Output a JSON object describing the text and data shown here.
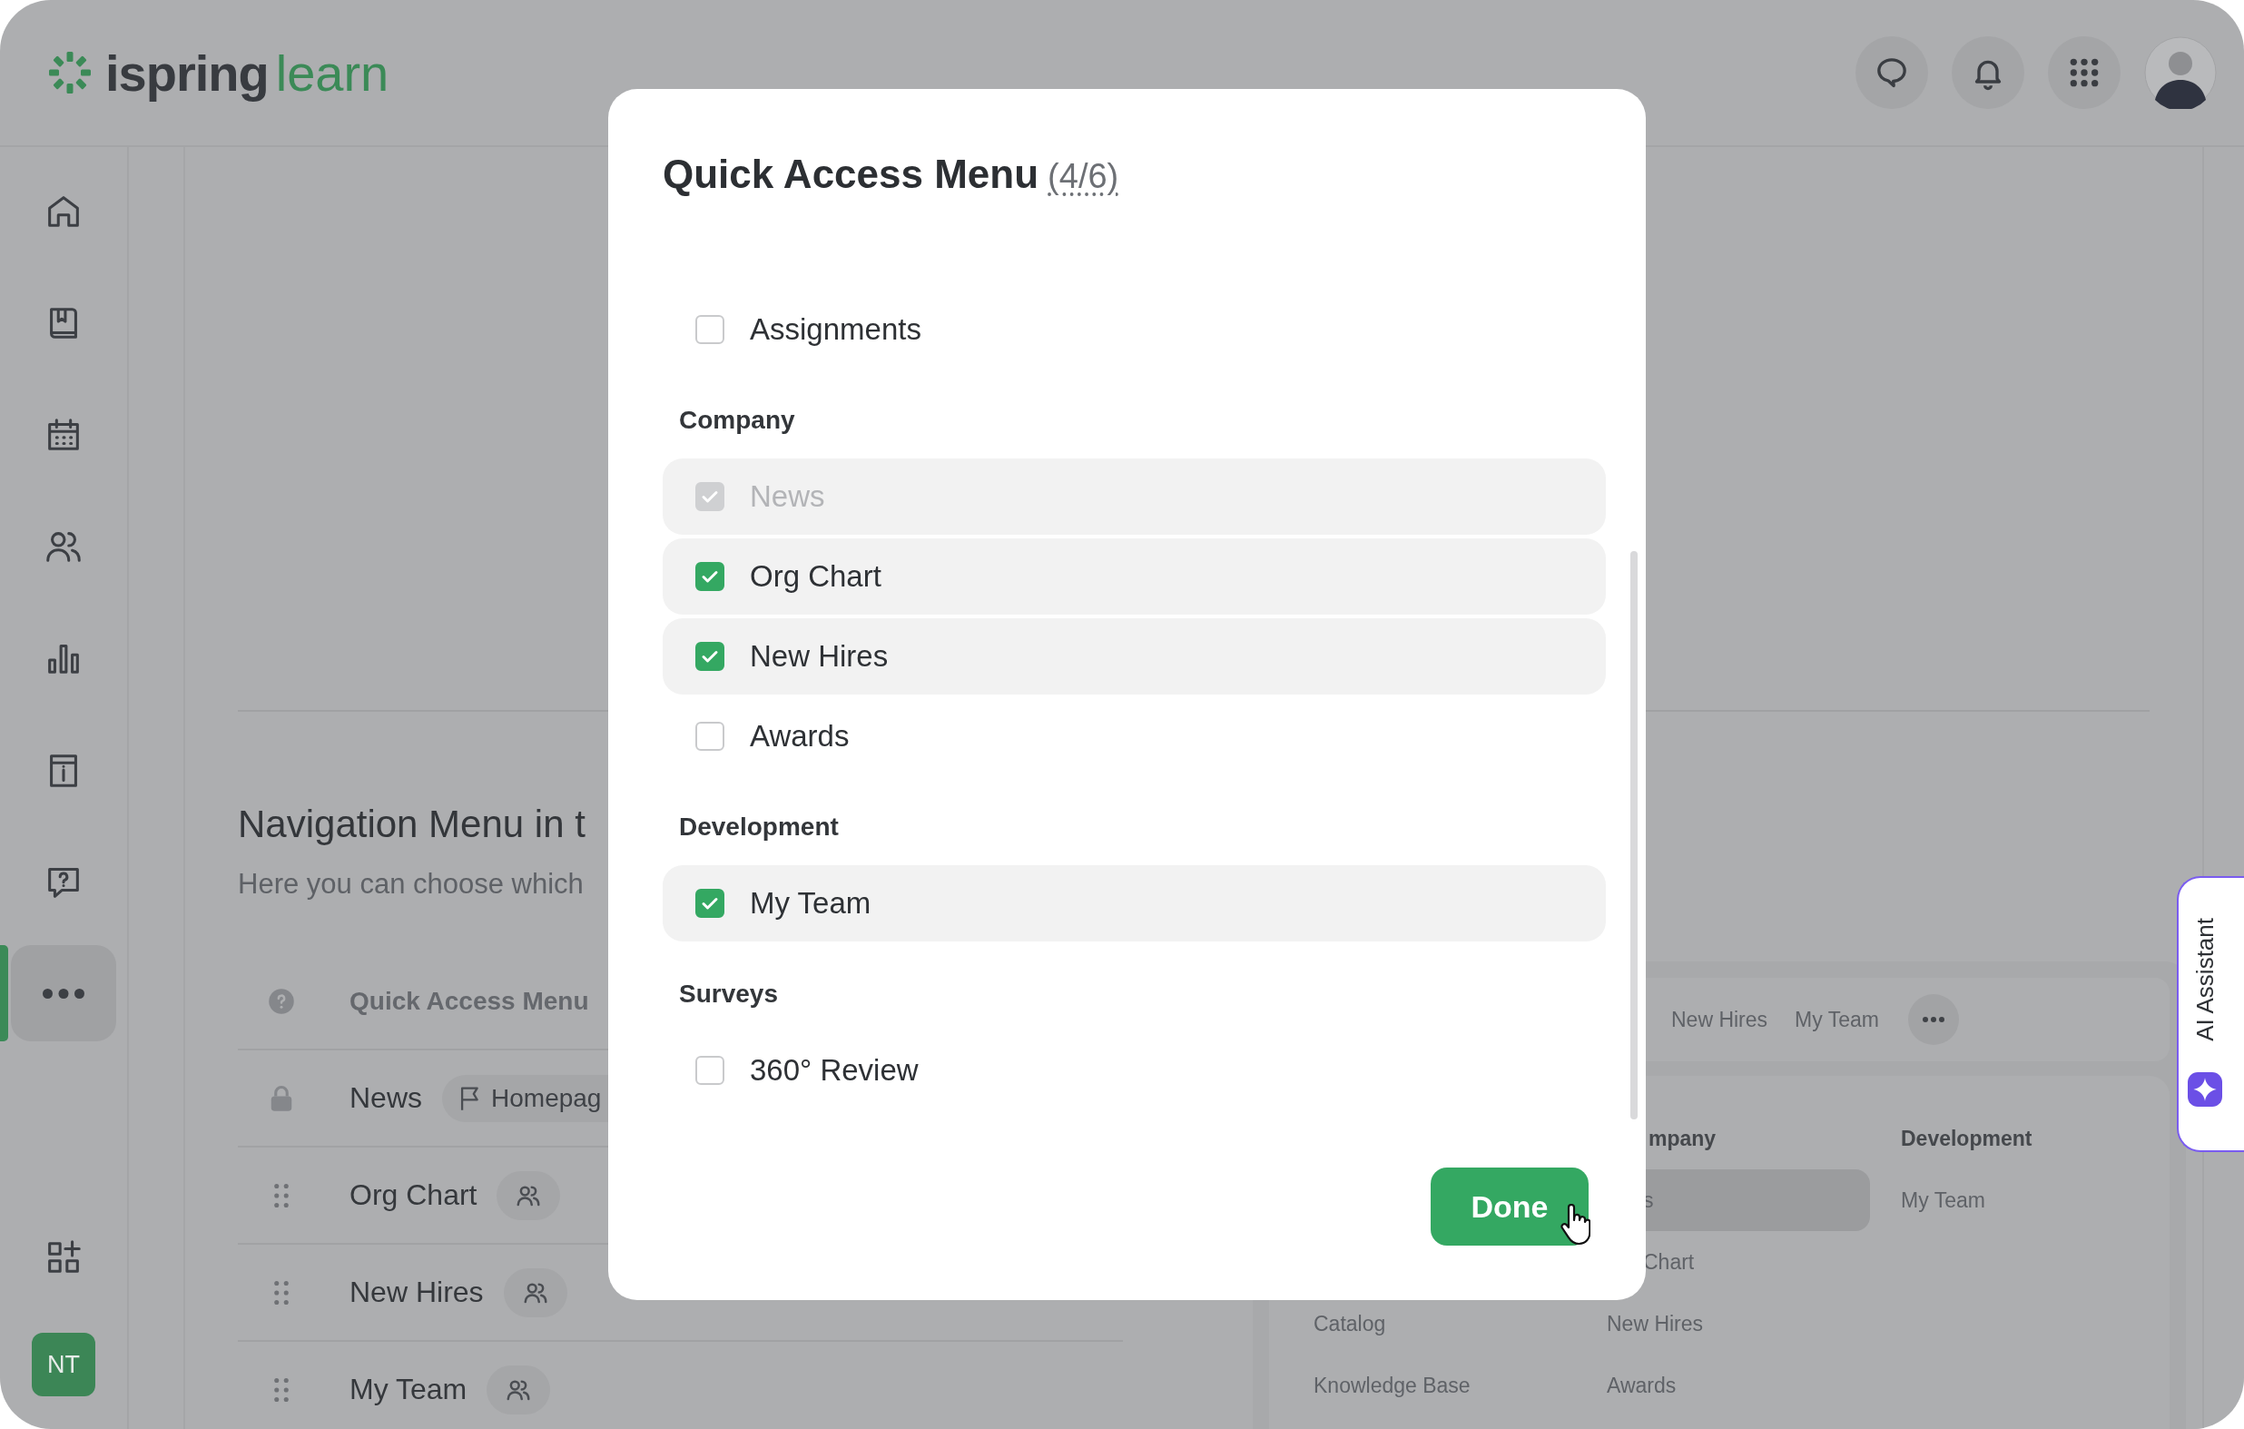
{
  "logo": {
    "brand": "ispring",
    "product": "learn"
  },
  "header_actions": [
    {
      "kind": "chat"
    },
    {
      "kind": "bell"
    },
    {
      "kind": "apps"
    }
  ],
  "sidebar": {
    "items": [
      {
        "kind": "home",
        "selected": false
      },
      {
        "kind": "book",
        "selected": false
      },
      {
        "kind": "calendar",
        "selected": false
      },
      {
        "kind": "people",
        "selected": false
      },
      {
        "kind": "chart",
        "selected": false
      },
      {
        "kind": "info",
        "selected": false
      },
      {
        "kind": "help",
        "selected": false
      },
      {
        "kind": "more",
        "selected": true
      }
    ],
    "bottom_items": [
      {
        "kind": "add-widget",
        "selected": false
      }
    ],
    "user_initials": "NT"
  },
  "page": {
    "title": "Navigation Menu in t",
    "subtitle": "Here you can choose which",
    "menu_items": [
      {
        "kind": "header",
        "label": "Quick Access Menu"
      },
      {
        "kind": "locked",
        "label": "News",
        "tag": "Homepag"
      },
      {
        "kind": "draggable",
        "label": "Org Chart"
      },
      {
        "kind": "draggable",
        "label": "New Hires"
      },
      {
        "kind": "draggable",
        "label": "My Team"
      }
    ]
  },
  "preview": {
    "top_items": [
      "New Hires",
      "My Team"
    ],
    "columns": [
      {
        "items": [
          {
            "label": "Catalog",
            "selected": false
          },
          {
            "label": "Knowledge Base",
            "selected": false
          }
        ]
      },
      {
        "heading": "mpany",
        "items": [
          {
            "label": "s",
            "selected": true
          },
          {
            "label": "Chart",
            "selected": false
          },
          {
            "label": "New Hires",
            "selected": false
          },
          {
            "label": "Awards",
            "selected": false
          }
        ]
      },
      {
        "heading": "Development",
        "items": [
          {
            "label": "My Team",
            "selected": false
          }
        ]
      }
    ]
  },
  "ai_assistant": {
    "label": "AI Assistant"
  },
  "dialog": {
    "title": "Quick Access Menu",
    "count": "(4/6)",
    "groups": [
      {
        "items": [
          {
            "label": "Assignments",
            "checked": false,
            "disabled": false
          }
        ]
      },
      {
        "heading": "Company",
        "items": [
          {
            "label": "News",
            "checked": true,
            "disabled": true
          },
          {
            "label": "Org Chart",
            "checked": true,
            "disabled": false
          },
          {
            "label": "New Hires",
            "checked": true,
            "disabled": false
          },
          {
            "label": "Awards",
            "checked": false,
            "disabled": false
          }
        ]
      },
      {
        "heading": "Development",
        "items": [
          {
            "label": "My Team",
            "checked": true,
            "disabled": false
          }
        ]
      },
      {
        "heading": "Surveys",
        "items": [
          {
            "label": "360° Review",
            "checked": false,
            "disabled": false
          }
        ]
      }
    ],
    "done_button": "Done"
  }
}
